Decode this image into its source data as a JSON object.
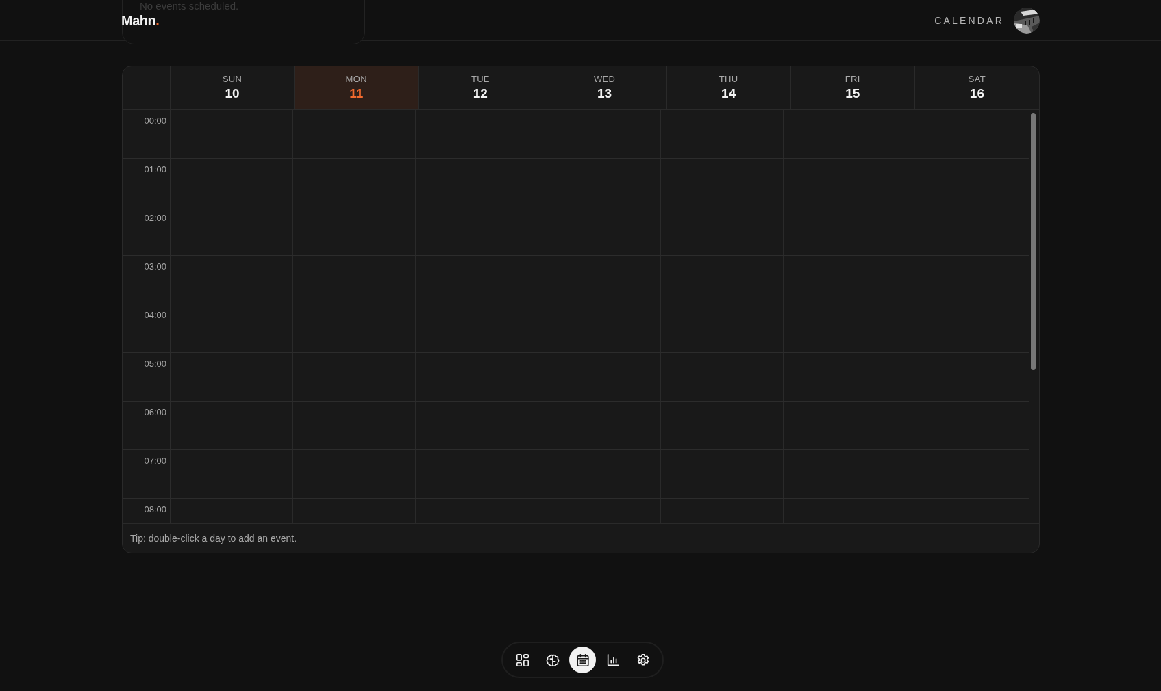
{
  "header": {
    "logo": {
      "name": "Mahn",
      "mark": "."
    },
    "page_title": "CALENDAR"
  },
  "popover": {
    "message": "No events scheduled."
  },
  "calendar": {
    "days": [
      {
        "weekday": "SUN",
        "date": "10",
        "selected": false
      },
      {
        "weekday": "MON",
        "date": "11",
        "selected": true
      },
      {
        "weekday": "TUE",
        "date": "12",
        "selected": false
      },
      {
        "weekday": "WED",
        "date": "13",
        "selected": false
      },
      {
        "weekday": "THU",
        "date": "14",
        "selected": false
      },
      {
        "weekday": "FRI",
        "date": "15",
        "selected": false
      },
      {
        "weekday": "SAT",
        "date": "16",
        "selected": false
      }
    ],
    "hours": [
      "00:00",
      "01:00",
      "02:00",
      "03:00",
      "04:00",
      "05:00",
      "06:00",
      "07:00",
      "08:00"
    ],
    "tip": "Tip: double-click a day to add an event."
  },
  "dock": [
    {
      "kind": "dashboard",
      "selected": false
    },
    {
      "kind": "brain",
      "selected": false
    },
    {
      "kind": "calendar",
      "selected": true
    },
    {
      "kind": "chart",
      "selected": false
    },
    {
      "kind": "settings",
      "selected": false
    }
  ]
}
